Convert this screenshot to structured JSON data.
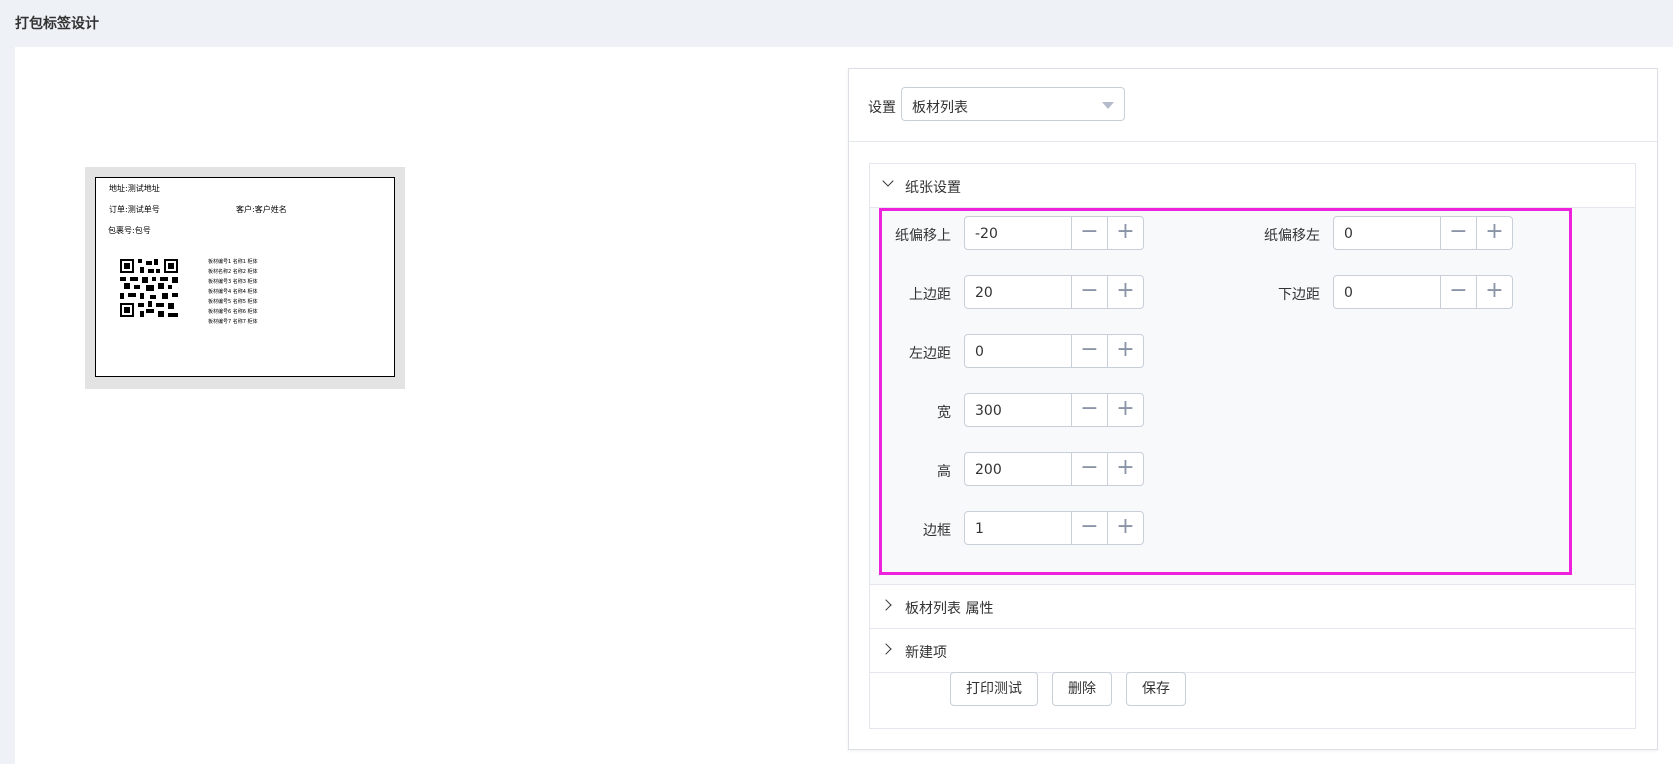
{
  "page_title": "打包标签设计",
  "preview": {
    "address": "地址:测试地址",
    "order": "订单:测试单号",
    "customer": "客户:客户姓名",
    "package": "包裹号:包号",
    "items": [
      "板材编号1 名称1 柜体",
      "板材名称2 名称2 柜体",
      "板材编号3 名称3 柜体",
      "板材编号4 名称4 柜体",
      "板材编号5 名称5 柜体",
      "板材编号6 名称6 柜体",
      "板材编号7 名称7 柜体"
    ]
  },
  "settings": {
    "label": "设置",
    "select_value": "板材列表"
  },
  "sections": {
    "paper": "纸张设置",
    "attrs": "板材列表 属性",
    "new_item": "新建项"
  },
  "fields": {
    "offset_top": {
      "label": "纸偏移上",
      "value": "-20"
    },
    "offset_left": {
      "label": "纸偏移左",
      "value": "0"
    },
    "margin_top": {
      "label": "上边距",
      "value": "20"
    },
    "margin_bottom": {
      "label": "下边距",
      "value": "0"
    },
    "margin_left": {
      "label": "左边距",
      "value": "0"
    },
    "width": {
      "label": "宽",
      "value": "300"
    },
    "height": {
      "label": "高",
      "value": "200"
    },
    "border": {
      "label": "边框",
      "value": "1"
    }
  },
  "stepper": {
    "minus": "−",
    "plus": "+"
  },
  "buttons": {
    "print_test": "打印测试",
    "delete": "删除",
    "save": "保存"
  },
  "colors": {
    "highlight": "#ee22dd"
  }
}
